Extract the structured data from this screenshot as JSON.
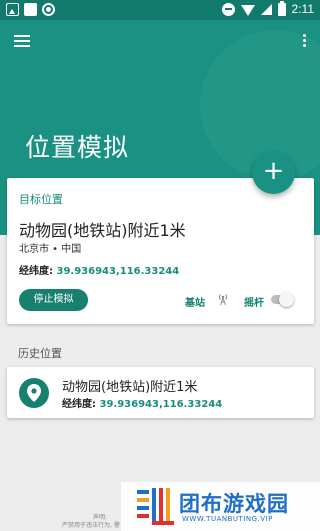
{
  "status_bar": {
    "time": "2:11"
  },
  "header": {
    "title": "位置模拟"
  },
  "target": {
    "label": "目标位置",
    "place": "动物园(地铁站)附近1米",
    "city": "北京市 • 中国",
    "coord_label": "经纬度:",
    "coord_value": "39.936943,116.33244",
    "stop_button": "停止模拟",
    "station_label": "基站",
    "joystick_label": "摇杆",
    "joystick_enabled": false
  },
  "fab": {
    "label": "+"
  },
  "history": {
    "title": "历史位置",
    "items": [
      {
        "place": "动物园(地铁站)附近1米",
        "coord_label": "经纬度:",
        "coord_value": "39.936943,116.33244"
      }
    ]
  },
  "footer": {
    "disclaimer_line1": "声明:",
    "disclaimer_line2": "严禁用于违法行为, 警"
  },
  "watermark": {
    "title": "团布游戏园",
    "subtitle": "WWW.TUANBUTING.VIP"
  },
  "colors": {
    "primary": "#1a9283",
    "primary_dark": "#127a6d",
    "accent_text": "#1a8c7e",
    "watermark": "#1f6ec8"
  }
}
